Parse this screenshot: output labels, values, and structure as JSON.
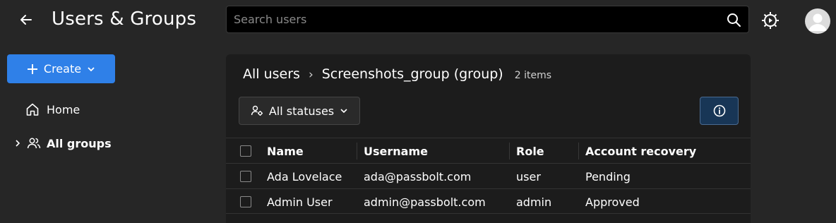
{
  "header": {
    "title": "Users & Groups",
    "search_placeholder": "Search users",
    "search_value": ""
  },
  "sidebar": {
    "create_label": "Create",
    "items": [
      {
        "label": "Home"
      },
      {
        "label": "All groups"
      }
    ]
  },
  "main": {
    "breadcrumb": {
      "root": "All users",
      "separator": "›",
      "current": "Screenshots_group (group)",
      "count": "2 items"
    },
    "filter_label": "All statuses",
    "table": {
      "columns": [
        "Name",
        "Username",
        "Role",
        "Account recovery"
      ],
      "rows": [
        {
          "name": "Ada Lovelace",
          "username": "ada@passbolt.com",
          "role": "user",
          "recovery": "Pending"
        },
        {
          "name": "Admin User",
          "username": "admin@passbolt.com",
          "role": "admin",
          "recovery": "Approved"
        }
      ]
    }
  },
  "colors": {
    "background": "#262626",
    "panel": "#1c1c1c",
    "primary": "#2f80e8",
    "info_button": "#183656"
  }
}
